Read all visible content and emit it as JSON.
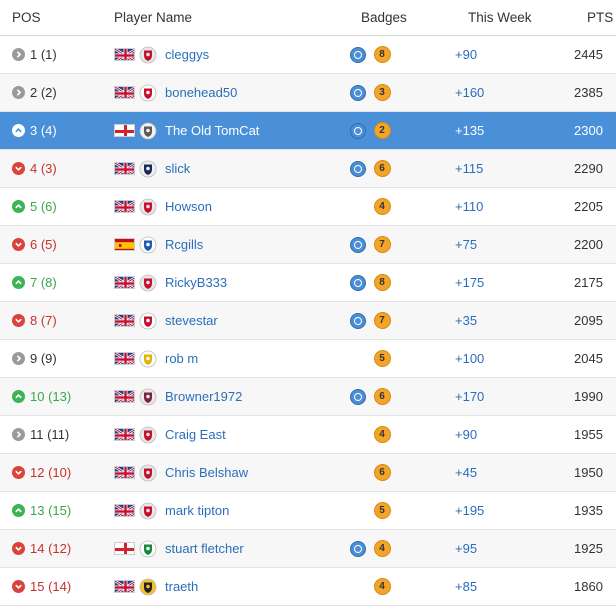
{
  "header": {
    "pos": "POS",
    "player": "Player Name",
    "badges": "Badges",
    "week": "This Week",
    "pts": "PTS"
  },
  "rows": [
    {
      "pos": "1 (1)",
      "move": "same",
      "flag": "uk",
      "crest": "red",
      "crest_icon": "liverbird-crest-icon",
      "player": "cleggys",
      "blue_badge": true,
      "gold": "8",
      "week": "+90",
      "pts": "2445"
    },
    {
      "pos": "2 (2)",
      "move": "same",
      "flag": "uk",
      "crest": "red-white",
      "crest_icon": "cherries-crest-icon",
      "player": "bonehead50",
      "blue_badge": true,
      "gold": "3",
      "week": "+160",
      "pts": "2385"
    },
    {
      "pos": "3 (4)",
      "move": "up",
      "flag": "eng",
      "crest": "grey",
      "crest_icon": "tomcat-crest-icon",
      "player": "The Old TomCat",
      "blue_badge": true,
      "gold": "2",
      "week": "+135",
      "pts": "2300",
      "highlight": true
    },
    {
      "pos": "4 (3)",
      "move": "down",
      "flag": "uk",
      "crest": "navy",
      "crest_icon": "eagle-crest-icon",
      "player": "slick",
      "blue_badge": true,
      "gold": "6",
      "week": "+115",
      "pts": "2290"
    },
    {
      "pos": "5 (6)",
      "move": "up",
      "flag": "uk",
      "crest": "red",
      "crest_icon": "devil-crest-icon",
      "player": "Howson",
      "blue_badge": false,
      "gold": "4",
      "week": "+110",
      "pts": "2205"
    },
    {
      "pos": "6 (5)",
      "move": "down",
      "flag": "es",
      "crest": "blue",
      "crest_icon": "stripes-crest-icon",
      "player": "Rcgills",
      "blue_badge": true,
      "gold": "7",
      "week": "+75",
      "pts": "2200"
    },
    {
      "pos": "7 (8)",
      "move": "up",
      "flag": "uk",
      "crest": "red",
      "crest_icon": "cannon-crest-icon",
      "player": "RickyB333",
      "blue_badge": true,
      "gold": "8",
      "week": "+175",
      "pts": "2175"
    },
    {
      "pos": "8 (7)",
      "move": "down",
      "flag": "uk",
      "crest": "red-white",
      "crest_icon": "cherries-crest-icon",
      "player": "stevestar",
      "blue_badge": true,
      "gold": "7",
      "week": "+35",
      "pts": "2095"
    },
    {
      "pos": "9 (9)",
      "move": "same",
      "flag": "uk",
      "crest": "yellow",
      "crest_icon": "white-rose-crest-icon",
      "player": "rob m",
      "blue_badge": false,
      "gold": "5",
      "week": "+100",
      "pts": "2045"
    },
    {
      "pos": "10 (13)",
      "move": "up",
      "flag": "uk",
      "crest": "claret",
      "crest_icon": "hammers-crest-icon",
      "player": "Browner1972",
      "blue_badge": true,
      "gold": "6",
      "week": "+170",
      "pts": "1990"
    },
    {
      "pos": "11 (11)",
      "move": "same",
      "flag": "uk",
      "crest": "red",
      "crest_icon": "devil-crest-icon",
      "player": "Craig East",
      "blue_badge": false,
      "gold": "4",
      "week": "+90",
      "pts": "1955"
    },
    {
      "pos": "12 (10)",
      "move": "down",
      "flag": "uk",
      "crest": "red",
      "crest_icon": "liverbird-crest-icon",
      "player": "Chris Belshaw",
      "blue_badge": false,
      "gold": "6",
      "week": "+45",
      "pts": "1950"
    },
    {
      "pos": "13 (15)",
      "move": "up",
      "flag": "uk",
      "crest": "red",
      "crest_icon": "tree-crest-icon",
      "player": "mark tipton",
      "blue_badge": false,
      "gold": "5",
      "week": "+195",
      "pts": "1935"
    },
    {
      "pos": "14 (12)",
      "move": "down",
      "flag": "eng",
      "crest": "green",
      "crest_icon": "celtic-crest-icon",
      "player": "stuart fletcher",
      "blue_badge": true,
      "gold": "4",
      "week": "+95",
      "pts": "1925"
    },
    {
      "pos": "15 (14)",
      "move": "down",
      "flag": "uk",
      "crest": "gold",
      "crest_icon": "wolf-crest-icon",
      "player": "traeth",
      "blue_badge": false,
      "gold": "4",
      "week": "+85",
      "pts": "1860"
    }
  ],
  "colors": {
    "highlight": "#4a90d9",
    "link": "#2a6ebb",
    "up": "#3cb453",
    "down": "#d9433b",
    "same": "#9a9a9a",
    "badge_gold": "#f3a52a",
    "badge_blue": "#4a8fd6"
  }
}
